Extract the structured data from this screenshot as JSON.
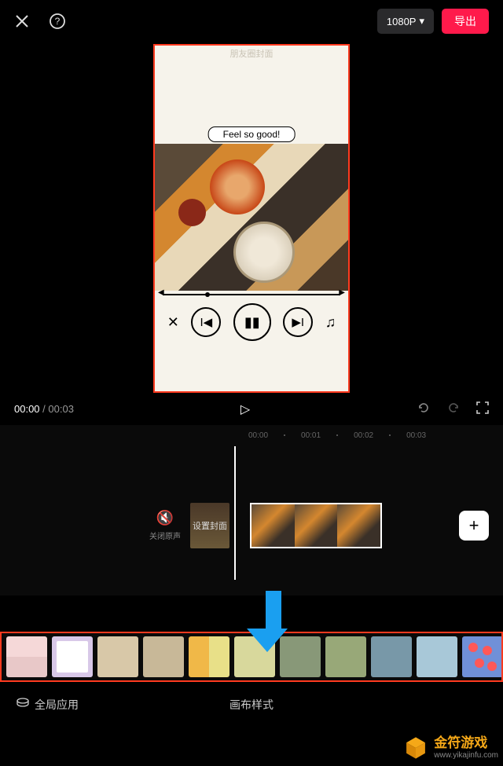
{
  "header": {
    "resolution_label": "1080P",
    "export_label": "导出"
  },
  "preview": {
    "faint_text": "朋友圈封面",
    "caption": "Feel so good!"
  },
  "playback": {
    "current_time": "00:00",
    "total_time": "00:03"
  },
  "ruler": [
    "00:00",
    "00:01",
    "00:02",
    "00:03"
  ],
  "track": {
    "audio_off_label": "关闭原声",
    "cover_label": "设置封面"
  },
  "bottom": {
    "global_apply": "全局应用",
    "canvas_style": "画布样式"
  },
  "watermark": {
    "brand": "金符游戏",
    "url": "www.yikajinfu.com"
  }
}
